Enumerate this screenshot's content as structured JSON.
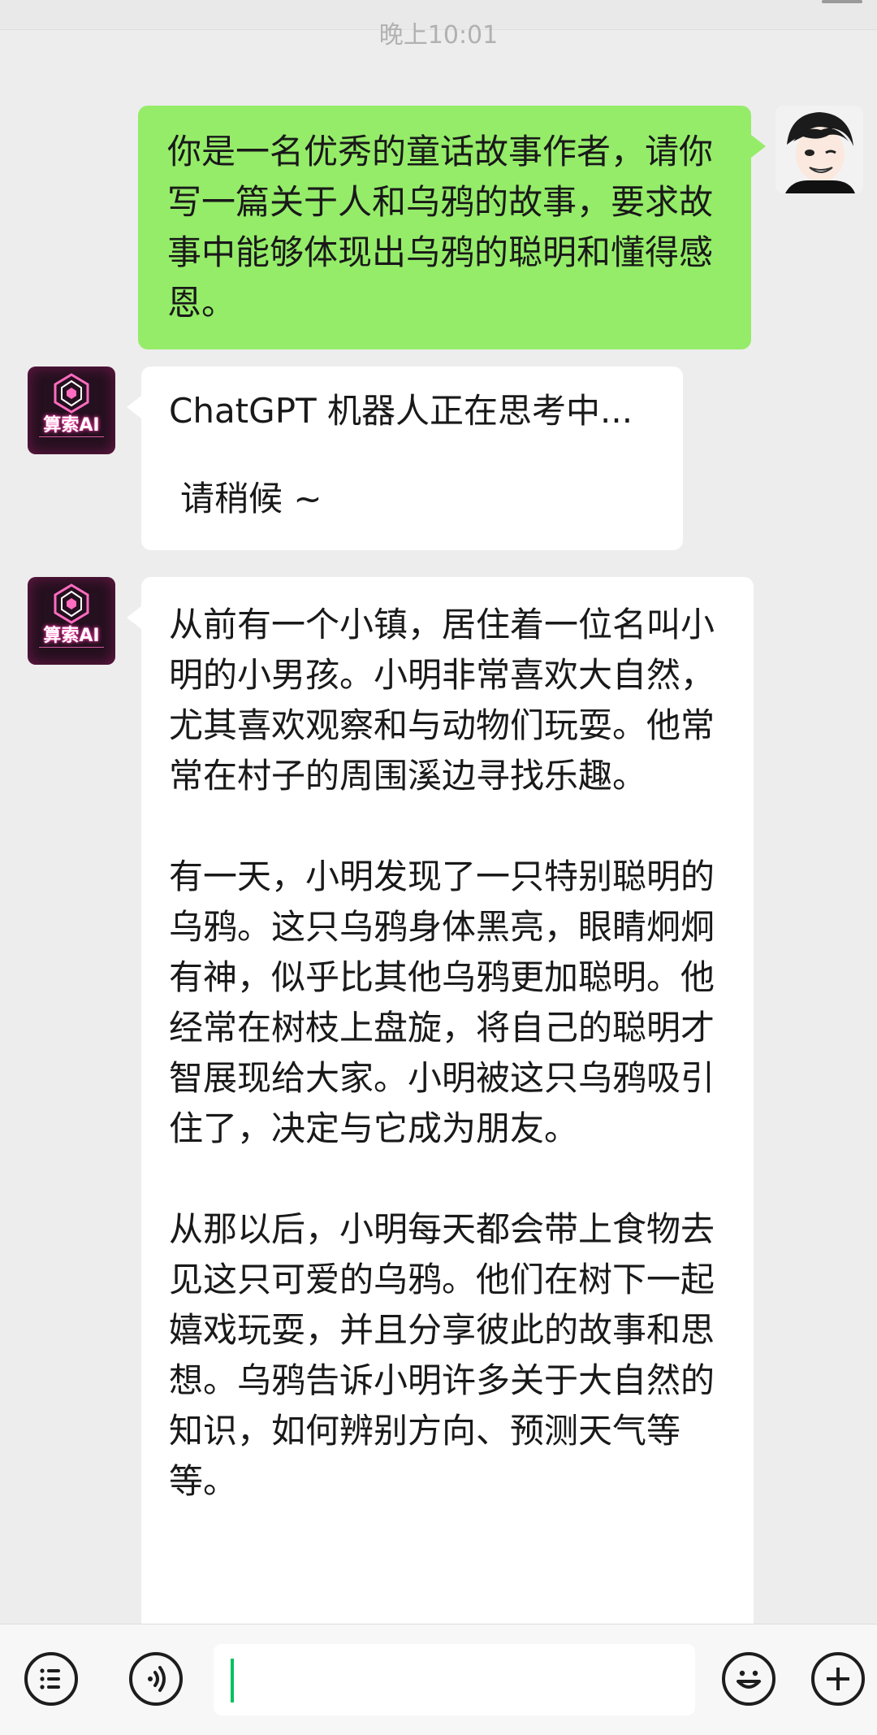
{
  "status": {
    "time_label": "晚上10:01"
  },
  "messages": {
    "user_prompt": "你是一名优秀的童话故事作者，请你写一篇关于人和乌鸦的故事，要求故事中能够体现出乌鸦的聪明和懂得感恩。",
    "bot_wait_line1": "ChatGPT 机器人正在思考中...",
    "bot_wait_line2": "请稍候 ~",
    "bot_story_paragraphs": [
      "从前有一个小镇，居住着一位名叫小明的小男孩。小明非常喜欢大自然，尤其喜欢观察和与动物们玩耍。他常常在村子的周围溪边寻找乐趣。",
      "有一天，小明发现了一只特别聪明的乌鸦。这只乌鸦身体黑亮，眼睛炯炯有神，似乎比其他乌鸦更加聪明。他经常在树枝上盘旋，将自己的聪明才智展现给大家。小明被这只乌鸦吸引住了，决定与它成为朋友。",
      "从那以后，小明每天都会带上食物去见这只可爱的乌鸦。他们在树下一起嬉戏玩耍，并且分享彼此的故事和思想。乌鸦告诉小明许多关于大自然的知识，如何辨别方向、预测天气等等。"
    ]
  },
  "bot": {
    "avatar_label": "算索AI",
    "avatar_icon": "cube-logo-icon"
  },
  "user": {
    "avatar_icon": "user-avatar-icon"
  },
  "input": {
    "value": "",
    "caret_color": "#07c160"
  },
  "colors": {
    "user_bubble": "#95ec69",
    "bot_bubble": "#ffffff",
    "background": "#ededed"
  },
  "toolbar": {
    "left_icons": [
      "list-icon",
      "voice-icon"
    ],
    "right_icons": [
      "emoji-icon",
      "plus-icon"
    ]
  }
}
